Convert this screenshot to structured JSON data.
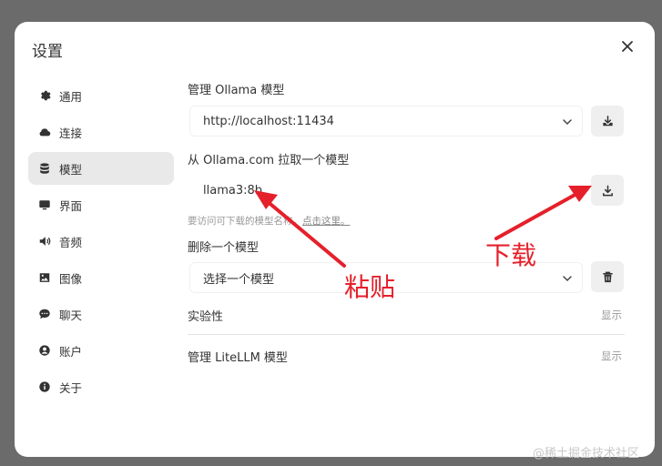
{
  "dialog": {
    "title": "设置"
  },
  "sidebar": {
    "items": [
      {
        "label": "通用",
        "icon": "gear-icon"
      },
      {
        "label": "连接",
        "icon": "cloud-icon"
      },
      {
        "label": "模型",
        "icon": "database-icon",
        "active": true
      },
      {
        "label": "界面",
        "icon": "monitor-icon"
      },
      {
        "label": "音频",
        "icon": "speaker-icon"
      },
      {
        "label": "图像",
        "icon": "image-icon"
      },
      {
        "label": "聊天",
        "icon": "chat-icon"
      },
      {
        "label": "账户",
        "icon": "account-icon"
      },
      {
        "label": "关于",
        "icon": "info-icon"
      }
    ]
  },
  "manage_ollama": {
    "label": "管理 Ollama 模型",
    "url_value": "http://localhost:11434"
  },
  "pull_model": {
    "label": "从 Ollama.com 拉取一个模型",
    "input_value": "llama3:8b",
    "hint_prefix": "要访问可下载的模型名称，",
    "hint_link": "点击这里。"
  },
  "delete_model": {
    "label": "删除一个模型",
    "select_value": "选择一个模型"
  },
  "experimental": {
    "label": "实验性",
    "toggle": "显示"
  },
  "litellm": {
    "label": "管理 LiteLLM 模型",
    "toggle": "显示"
  },
  "annotations": {
    "paste": "粘贴",
    "download": "下载"
  },
  "watermark": "@稀土掘金技术社区",
  "colors": {
    "annotation": "#e5202b",
    "overlay": "#6b6b6b",
    "active_item": "#e9e9e9"
  }
}
